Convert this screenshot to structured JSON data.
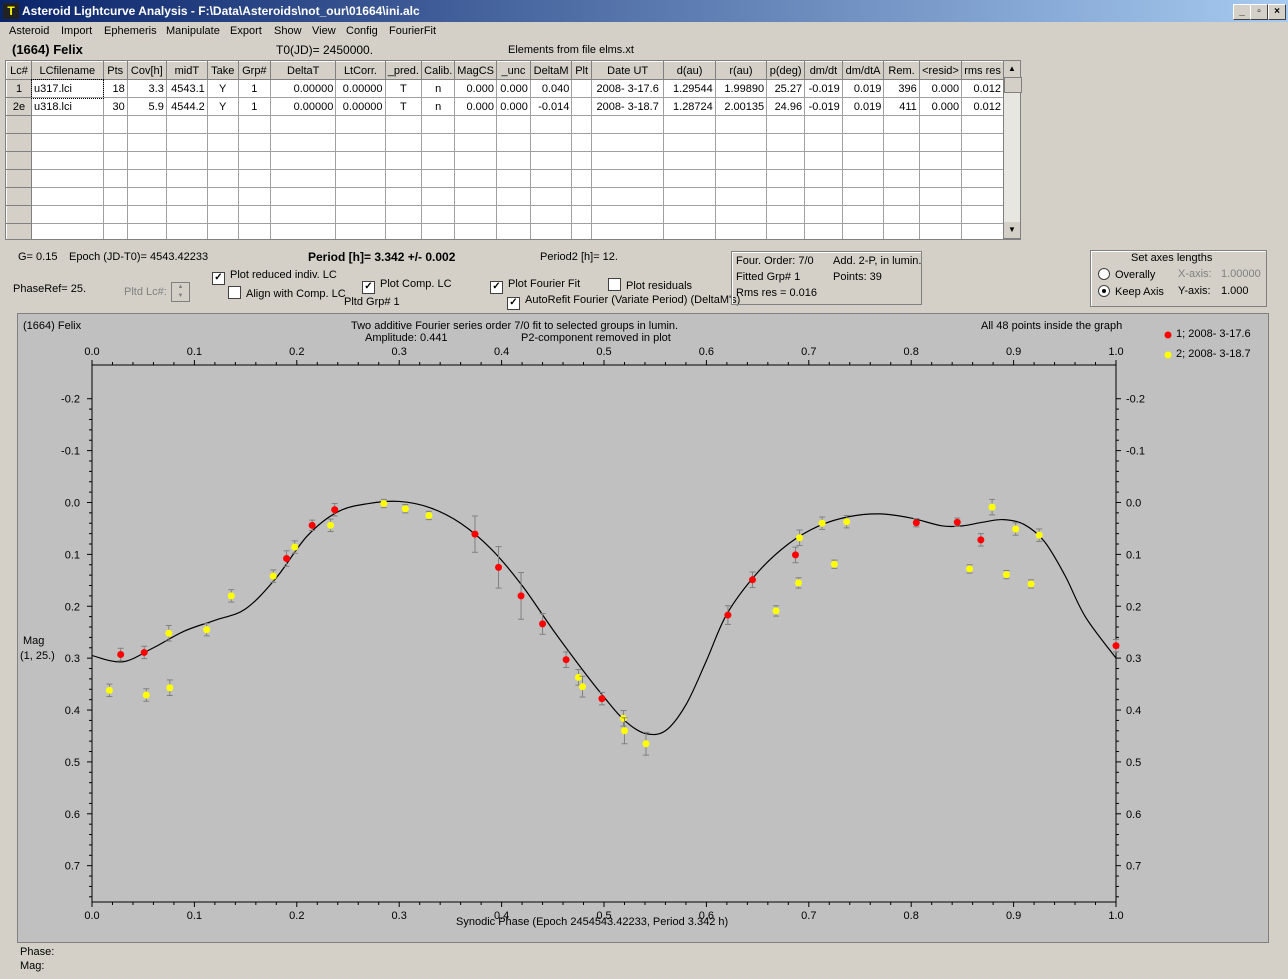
{
  "window": {
    "title": "Asteroid Lightcurve Analysis - F:\\Data\\Asteroids\\not_our\\01664\\ini.alc",
    "icon_text": "T",
    "minimize": "_",
    "restore": "▫",
    "close": "×"
  },
  "menu": [
    "Asteroid",
    "Import",
    "Ephemeris",
    "Manipulate",
    "Export",
    "Show",
    "View",
    "Config",
    "FourierFit"
  ],
  "header": {
    "object": "(1664) Felix",
    "t0": "T0(JD)= 2450000.",
    "elements": "Elements from file elms.xt"
  },
  "table": {
    "columns": [
      "Lc#",
      "LCfilename",
      "Pts",
      "Cov[h]",
      "midT",
      "Take",
      "Grp#",
      "DeltaT",
      "LtCorr.",
      "_pred.",
      "Calib.",
      "MagCS",
      "_unc",
      "DeltaM",
      "Plt",
      "Date UT",
      "d(au)",
      "r(au)",
      "p(deg)",
      "dm/dt",
      "dm/dtA",
      "Rem.",
      "<resid>",
      "rms res"
    ],
    "rows": [
      [
        "1",
        "u317.lci",
        "18",
        "3.3",
        "4543.1",
        "Y",
        "1",
        "0.00000",
        "0.00000",
        "T",
        "n",
        "0.000",
        "0.000",
        "0.040",
        "",
        "2008- 3-17.6",
        "1.29544",
        "1.99890",
        "25.27",
        "-0.019",
        "0.019",
        "396",
        "0.000",
        "0.012"
      ],
      [
        "2e",
        "u318.lci",
        "30",
        "5.9",
        "4544.2",
        "Y",
        "1",
        "0.00000",
        "0.00000",
        "T",
        "n",
        "0.000",
        "0.000",
        "-0.014",
        "",
        "2008- 3-18.7",
        "1.28724",
        "2.00135",
        "24.96",
        "-0.019",
        "0.019",
        "411",
        "0.000",
        "0.012"
      ]
    ],
    "empty_rows": 7
  },
  "params": {
    "g": "G= 0.15",
    "epoch": "Epoch (JD-T0)= 4543.42233",
    "period": "Period [h]= 3.342 +/- 0.002",
    "period2": "Period2 [h]= 12.",
    "phaseref": "PhaseRef= 25.",
    "pltd_lc": "Pltd Lc#:",
    "pltd_grp": "Pltd Grp#  1"
  },
  "checkboxes": {
    "plot_reduced": {
      "label": "Plot reduced indiv. LC",
      "checked": true
    },
    "align_comp": {
      "label": "Align with Comp. LC",
      "checked": false
    },
    "plot_comp": {
      "label": "Plot Comp. LC",
      "checked": true
    },
    "plot_fourier": {
      "label": "Plot Fourier Fit",
      "checked": true
    },
    "plot_residuals": {
      "label": "Plot residuals",
      "checked": false
    },
    "autorefit": {
      "label": "AutoRefit Fourier (Variate Period) (DeltaM's)",
      "checked": true
    }
  },
  "fourier_info": {
    "order": "Four. Order:  7/0",
    "add2p": "Add. 2-P, in lumin.",
    "fitted": "Fitted Grp# 1",
    "points": "Points: 39",
    "rms": "Rms res     = 0.016"
  },
  "axes_box": {
    "title": "Set axes lengths",
    "overally": "Overally",
    "keep_axis": "Keep Axis",
    "x_axis_label": "X-axis:",
    "x_axis_value": "1.00000",
    "y_axis_label": "Y-axis:",
    "y_axis_value": "1.000",
    "selected": "keep_axis"
  },
  "plot": {
    "object": "(1664) Felix",
    "caption1": "Two additive Fourier series order 7/0 fit to selected groups in lumin.",
    "caption2a": "Amplitude: 0.441",
    "caption2b": "P2-component removed in plot",
    "inside": "All 48 points inside the graph",
    "ylabel1": "Mag",
    "ylabel2": "(1, 25.)",
    "xlabel": "Synodic Phase (Epoch 2454543.42233, Period 3.342 h)",
    "phase_label": "Phase:",
    "mag_label": "Mag:"
  },
  "chart_data": {
    "type": "scatter",
    "x_ticks": [
      "0.0",
      "0.1",
      "0.2",
      "0.3",
      "0.4",
      "0.5",
      "0.6",
      "0.7",
      "0.8",
      "0.9",
      "1.0"
    ],
    "y_ticks": [
      "-0.2",
      "-0.1",
      "0.0",
      "0.1",
      "0.2",
      "0.3",
      "0.4",
      "0.5",
      "0.6",
      "0.7"
    ],
    "xlim": [
      0,
      1
    ],
    "ylim": [
      -0.265,
      0.77
    ],
    "y_inverted": true,
    "colors": {
      "red": "#ff0000",
      "yellow": "#ffff00",
      "curve": "#000000"
    },
    "series": [
      {
        "name": "1; 2008- 3-17.6",
        "color": "#ff0000",
        "x": [
          0.028,
          0.051,
          0.19,
          0.215,
          0.237,
          0.374,
          0.397,
          0.419,
          0.44,
          0.463,
          0.498,
          0.621,
          0.645,
          0.687,
          0.805,
          0.845,
          0.868,
          1.0
        ],
        "y": [
          0.293,
          0.289,
          0.108,
          0.044,
          0.014,
          0.061,
          0.125,
          0.18,
          0.234,
          0.303,
          0.378,
          0.217,
          0.149,
          0.101,
          0.039,
          0.038,
          0.072,
          0.276
        ],
        "err": [
          0.012,
          0.012,
          0.015,
          0.01,
          0.012,
          0.035,
          0.04,
          0.045,
          0.02,
          0.015,
          0.012,
          0.018,
          0.015,
          0.015,
          0.008,
          0.008,
          0.012,
          0.012
        ]
      },
      {
        "name": "2; 2008- 3-18.7",
        "color": "#ffff00",
        "x": [
          0.017,
          0.053,
          0.075,
          0.076,
          0.112,
          0.136,
          0.177,
          0.198,
          0.233,
          0.285,
          0.306,
          0.329,
          0.475,
          0.479,
          0.519,
          0.52,
          0.541,
          0.668,
          0.69,
          0.691,
          0.713,
          0.725,
          0.737,
          0.857,
          0.879,
          0.893,
          0.902,
          0.917,
          0.925
        ],
        "y": [
          0.362,
          0.371,
          0.252,
          0.357,
          0.245,
          0.18,
          0.142,
          0.086,
          0.044,
          0.002,
          0.012,
          0.025,
          0.337,
          0.355,
          0.416,
          0.44,
          0.465,
          0.209,
          0.155,
          0.068,
          0.04,
          0.119,
          0.037,
          0.128,
          0.009,
          0.139,
          0.051,
          0.157,
          0.063
        ],
        "err": [
          0.012,
          0.012,
          0.015,
          0.015,
          0.012,
          0.012,
          0.012,
          0.012,
          0.012,
          0.008,
          0.008,
          0.008,
          0.015,
          0.02,
          0.015,
          0.025,
          0.022,
          0.01,
          0.01,
          0.015,
          0.012,
          0.008,
          0.012,
          0.008,
          0.015,
          0.008,
          0.012,
          0.008,
          0.012
        ]
      }
    ],
    "fit_curve": {
      "x": [
        0.0,
        0.03,
        0.06,
        0.09,
        0.12,
        0.15,
        0.18,
        0.21,
        0.24,
        0.27,
        0.3,
        0.33,
        0.36,
        0.39,
        0.42,
        0.45,
        0.48,
        0.5,
        0.52,
        0.54,
        0.56,
        0.58,
        0.6,
        0.62,
        0.65,
        0.68,
        0.71,
        0.74,
        0.77,
        0.8,
        0.83,
        0.85,
        0.87,
        0.89,
        0.91,
        0.93,
        0.95,
        0.97,
        1.0
      ],
      "y": [
        0.295,
        0.307,
        0.28,
        0.248,
        0.227,
        0.205,
        0.145,
        0.065,
        0.018,
        0.002,
        -0.002,
        0.01,
        0.04,
        0.09,
        0.16,
        0.245,
        0.325,
        0.375,
        0.42,
        0.445,
        0.44,
        0.39,
        0.305,
        0.215,
        0.135,
        0.08,
        0.045,
        0.027,
        0.022,
        0.03,
        0.045,
        0.045,
        0.038,
        0.033,
        0.042,
        0.075,
        0.14,
        0.22,
        0.3
      ]
    }
  }
}
